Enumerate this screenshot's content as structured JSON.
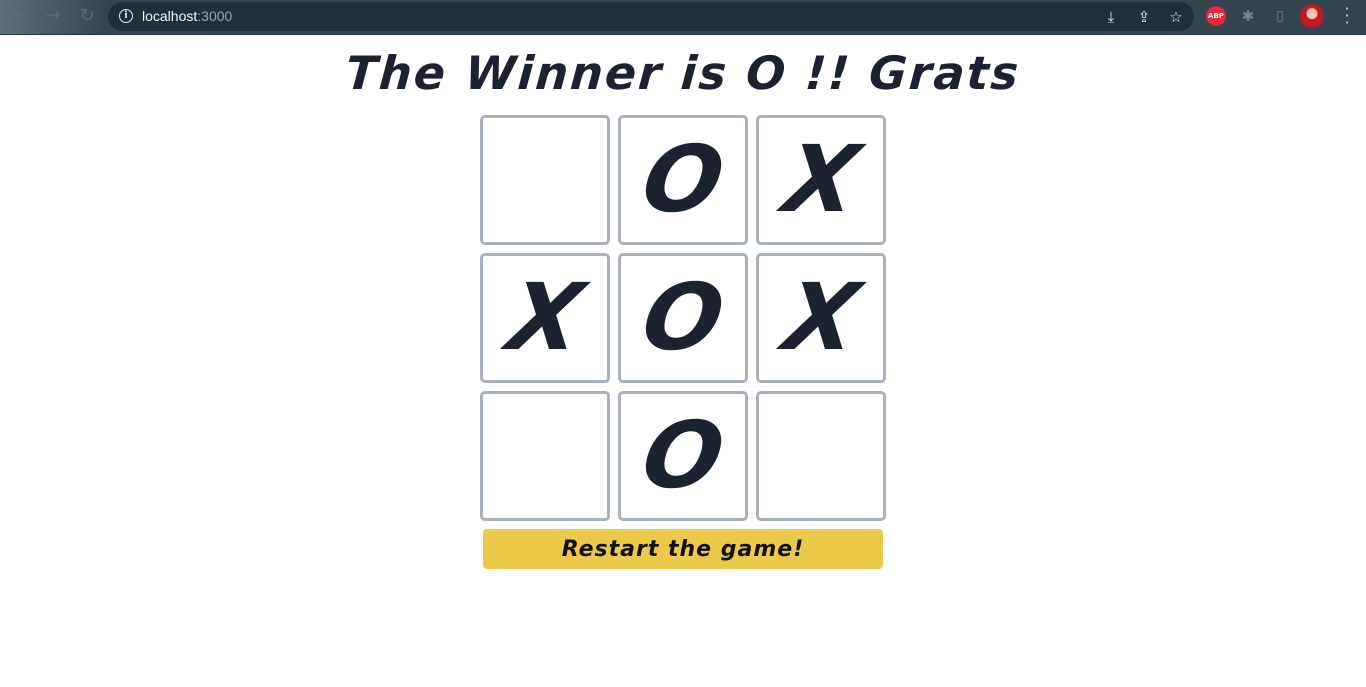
{
  "browser": {
    "back_glyph": "←",
    "forward_glyph": "→",
    "reload_glyph": "↻",
    "url_host": "localhost",
    "url_port": ":3000",
    "extension_abp_label": "ABP",
    "icons": [
      "info-icon",
      "install-icon",
      "share-icon",
      "star-icon",
      "abp-extension-icon",
      "puzzle-icon",
      "side-panel-icon",
      "avatar",
      "menu-icon"
    ]
  },
  "game": {
    "title": "The Winner is O !! Grats",
    "board": [
      [
        "",
        "O",
        "X"
      ],
      [
        "X",
        "O",
        "X"
      ],
      [
        "",
        "O",
        ""
      ]
    ],
    "restart_label": "Restart the game!"
  },
  "colors": {
    "text": "#1b2230",
    "cell_border": "#a6b2bf",
    "button": "#ecc94b"
  }
}
